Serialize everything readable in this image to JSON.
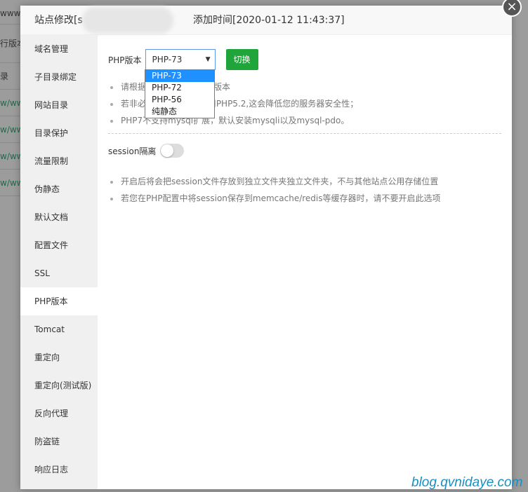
{
  "background": {
    "rows": [
      "www.f",
      "行版本",
      "录",
      "w/www",
      "w/www",
      "w/www",
      "w/www"
    ]
  },
  "modal": {
    "title_prefix": "站点修改[s",
    "title_suffix": "添加时间[2020-01-12 11:43:37]",
    "close_icon": "×"
  },
  "sidebar": {
    "items": [
      "域名管理",
      "子目录绑定",
      "网站目录",
      "目录保护",
      "流量限制",
      "伪静态",
      "默认文档",
      "配置文件",
      "SSL",
      "PHP版本",
      "Tomcat",
      "重定向",
      "重定向(测试版)",
      "反向代理",
      "防盗链",
      "响应日志"
    ],
    "active": "PHP版本"
  },
  "php": {
    "label": "PHP版本",
    "selected": "PHP-73",
    "options": [
      "PHP-73",
      "PHP-72",
      "PHP-56",
      "纯静态"
    ],
    "switch_button": "切换",
    "notes": [
      "请根据您的程序需求选择版本",
      "若非必要,请尽量不要使用PHP5.2,这会降低您的服务器安全性；",
      "PHP7不支持mysql扩展，默认安装mysqli以及mysql-pdo。"
    ]
  },
  "session": {
    "label": "session隔离",
    "enabled": false,
    "notes": [
      "开启后将会把session文件存放到独立文件夹独立文件夹，不与其他站点公用存储位置",
      "若您在PHP配置中将session保存到memcache/redis等缓存器时，请不要开启此选项"
    ]
  },
  "watermark": "blog.qvnidaye.com",
  "colors": {
    "accent": "#20a53a",
    "highlight": "#1e90ff"
  }
}
